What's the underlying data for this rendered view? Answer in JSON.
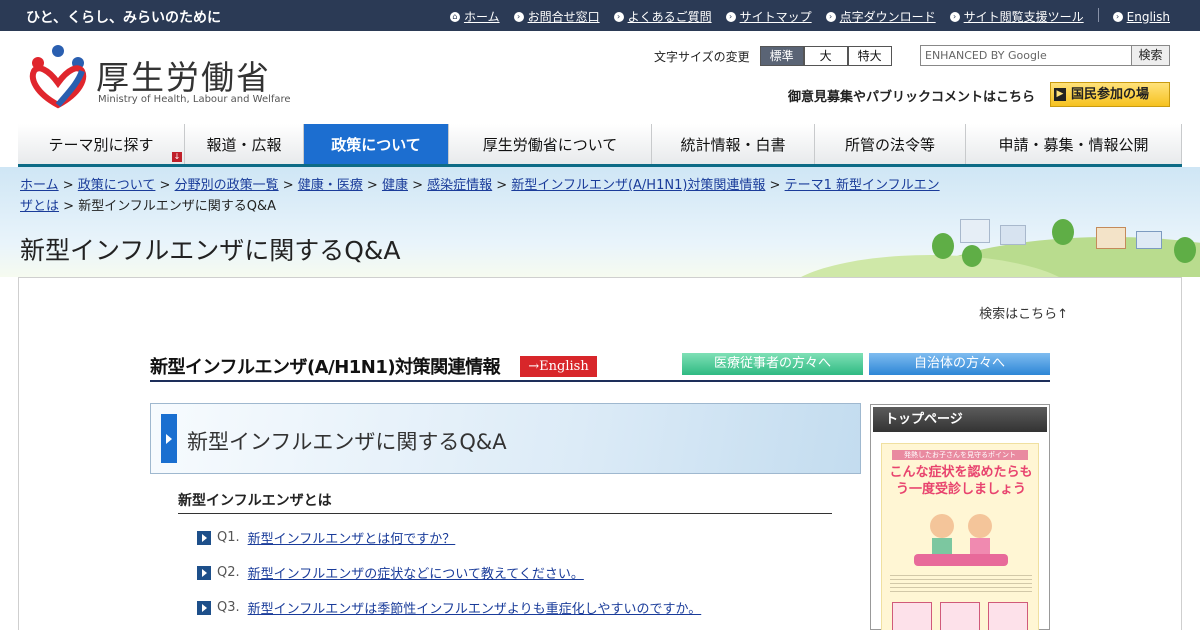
{
  "topbar": {
    "tagline": "ひと、くらし、みらいのために",
    "links": [
      "ホーム",
      "お問合せ窓口",
      "よくあるご質問",
      "サイトマップ",
      "点字ダウンロード",
      "サイト閲覧支援ツール"
    ],
    "english": "English"
  },
  "header": {
    "title": "厚生労働省",
    "subtitle": "Ministry of Health, Labour and Welfare",
    "fontsize_label": "文字サイズの変更",
    "fontsize_options": [
      "標準",
      "大",
      "特大"
    ],
    "search_placeholder": "ENHANCED BY Google",
    "search_button": "検索",
    "public_comment": "御意見募集やパブリックコメントはこちら",
    "kokumin": "国民参加の場"
  },
  "nav": [
    "テーマ別に探す",
    "報道・広報",
    "政策について",
    "厚生労働省について",
    "統計情報・白書",
    "所管の法令等",
    "申請・募集・情報公開"
  ],
  "breadcrumb": {
    "links": [
      "ホーム",
      "政策について",
      "分野別の政策一覧",
      "健康・医療",
      "健康",
      "感染症情報",
      "新型インフルエンザ(A/H1N1)対策関連情報",
      "テーマ1 新型インフルエンザとは"
    ],
    "current": "新型インフルエンザに関するQ&A"
  },
  "page_title": "新型インフルエンザに関するQ&A",
  "search_here": "検索はこちら↑",
  "section": {
    "title": "新型インフルエンザ(A/H1N1)対策関連情報",
    "english_button": "→English",
    "medical_button": "医療従事者の方々へ",
    "local_gov_button": "自治体の方々へ"
  },
  "qa": {
    "title": "新型インフルエンザに関するQ&A",
    "subhead": "新型インフルエンザとは",
    "questions": [
      {
        "num": "Q1.",
        "text": "新型インフルエンザとは何ですか？"
      },
      {
        "num": "Q2.",
        "text": "新型インフルエンザの症状などについて教えてください。"
      },
      {
        "num": "Q3.",
        "text": "新型インフルエンザは季節性インフルエンザよりも重症化しやすいのですか。"
      }
    ]
  },
  "sidebar": {
    "heading": "トップページ",
    "poster_small": "発熱したお子さんを見守るポイント",
    "poster_main": "こんな症状を認めたらもう一度受診しましょう"
  },
  "colors": {
    "topbar": "#2b3a55",
    "nav_active": "#1c6ed0",
    "nav_underline": "#0d6b86",
    "link": "#1a3c9a",
    "english_button": "#d8262a"
  }
}
